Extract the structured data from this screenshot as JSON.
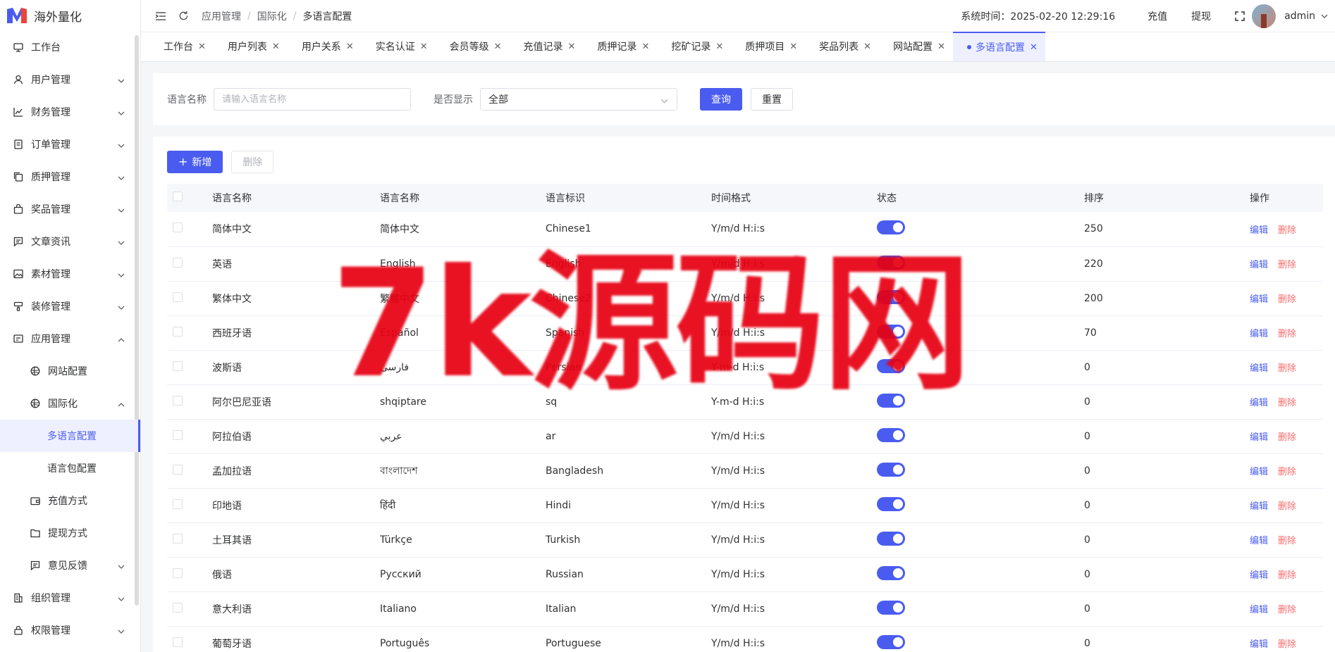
{
  "app": {
    "title": "海外量化"
  },
  "sidebar": {
    "items": [
      {
        "label": "工作台",
        "icon": "monitor-icon",
        "level": 0,
        "expandable": false
      },
      {
        "label": "用户管理",
        "icon": "user-icon",
        "level": 0,
        "expandable": true
      },
      {
        "label": "财务管理",
        "icon": "chart-icon",
        "level": 0,
        "expandable": true
      },
      {
        "label": "订单管理",
        "icon": "document-icon",
        "level": 0,
        "expandable": true
      },
      {
        "label": "质押管理",
        "icon": "copy-icon",
        "level": 0,
        "expandable": true
      },
      {
        "label": "奖品管理",
        "icon": "bag-icon",
        "level": 0,
        "expandable": true
      },
      {
        "label": "文章资讯",
        "icon": "message-icon",
        "level": 0,
        "expandable": true
      },
      {
        "label": "素材管理",
        "icon": "image-icon",
        "level": 0,
        "expandable": true
      },
      {
        "label": "装修管理",
        "icon": "brush-icon",
        "level": 0,
        "expandable": true
      },
      {
        "label": "应用管理",
        "icon": "app-icon",
        "level": 0,
        "expandable": true,
        "expanded": true
      },
      {
        "label": "网站配置",
        "icon": "globe-icon",
        "level": 1,
        "expandable": false
      },
      {
        "label": "国际化",
        "icon": "globe-icon",
        "level": 1,
        "expandable": true,
        "expanded": true
      },
      {
        "label": "多语言配置",
        "icon": "",
        "level": 2,
        "expandable": false,
        "active": true
      },
      {
        "label": "语言包配置",
        "icon": "",
        "level": 2,
        "expandable": false
      },
      {
        "label": "充值方式",
        "icon": "wallet-icon",
        "level": 1,
        "expandable": false
      },
      {
        "label": "提现方式",
        "icon": "folder-icon",
        "level": 1,
        "expandable": false
      },
      {
        "label": "意见反馈",
        "icon": "message-icon",
        "level": 1,
        "expandable": true
      },
      {
        "label": "组织管理",
        "icon": "building-icon",
        "level": 0,
        "expandable": true
      },
      {
        "label": "权限管理",
        "icon": "lock-icon",
        "level": 0,
        "expandable": true
      }
    ]
  },
  "header": {
    "breadcrumb": [
      "应用管理",
      "国际化",
      "多语言配置"
    ],
    "system_time": "系统时间：2025-02-20 12:29:16",
    "recharge": "充值",
    "withdraw": "提现",
    "user": "admin"
  },
  "tabs": [
    {
      "label": "工作台"
    },
    {
      "label": "用户列表"
    },
    {
      "label": "用户关系"
    },
    {
      "label": "实名认证"
    },
    {
      "label": "会员等级"
    },
    {
      "label": "充值记录"
    },
    {
      "label": "质押记录"
    },
    {
      "label": "挖矿记录"
    },
    {
      "label": "质押项目"
    },
    {
      "label": "奖品列表"
    },
    {
      "label": "网站配置"
    },
    {
      "label": "多语言配置",
      "active": true
    }
  ],
  "search": {
    "name_label": "语言名称",
    "name_placeholder": "请输入语言名称",
    "show_label": "是否显示",
    "show_value": "全部",
    "query": "查询",
    "reset": "重置"
  },
  "toolbar": {
    "add": "新增",
    "delete": "删除"
  },
  "table": {
    "columns": [
      "语言名称",
      "语言名称",
      "语言标识",
      "时间格式",
      "状态",
      "排序",
      "操作"
    ],
    "edit": "编辑",
    "remove": "删除",
    "rows": [
      {
        "name": "简体中文",
        "native": "简体中文",
        "code": "Chinese1",
        "fmt": "Y/m/d H:i:s",
        "on": true,
        "sort": "250"
      },
      {
        "name": "英语",
        "native": "English",
        "code": "English",
        "fmt": "Y/m/d H:i:s",
        "on": true,
        "sort": "220"
      },
      {
        "name": "繁体中文",
        "native": "繁體中文",
        "code": "Chinese2",
        "fmt": "Y/m/d H:i:s",
        "on": true,
        "sort": "200"
      },
      {
        "name": "西班牙语",
        "native": "Español",
        "code": "Spanish",
        "fmt": "Y/m/d H:i:s",
        "on": true,
        "sort": "70"
      },
      {
        "name": "波斯语",
        "native": "فارسی",
        "code": "Persian",
        "fmt": "Y-m-d H:i:s",
        "on": true,
        "sort": "0"
      },
      {
        "name": "阿尔巴尼亚语",
        "native": "shqiptare",
        "code": "sq",
        "fmt": "Y-m-d H:i:s",
        "on": true,
        "sort": "0"
      },
      {
        "name": "阿拉伯语",
        "native": "عربي",
        "code": "ar",
        "fmt": "Y/m/d H:i:s",
        "on": true,
        "sort": "0"
      },
      {
        "name": "孟加拉语",
        "native": "বাংলাদেশ",
        "code": "Bangladesh",
        "fmt": "Y/m/d H:i:s",
        "on": true,
        "sort": "0"
      },
      {
        "name": "印地语",
        "native": "हिंदी",
        "code": "Hindi",
        "fmt": "Y/m/d H:i:s",
        "on": true,
        "sort": "0"
      },
      {
        "name": "土耳其语",
        "native": "Türkçe",
        "code": "Turkish",
        "fmt": "Y/m/d H:i:s",
        "on": true,
        "sort": "0"
      },
      {
        "name": "俄语",
        "native": "Русский",
        "code": "Russian",
        "fmt": "Y/m/d H:i:s",
        "on": true,
        "sort": "0"
      },
      {
        "name": "意大利语",
        "native": "Italiano",
        "code": "Italian",
        "fmt": "Y/m/d H:i:s",
        "on": true,
        "sort": "0"
      },
      {
        "name": "葡萄牙语",
        "native": "Português",
        "code": "Portuguese",
        "fmt": "Y/m/d H:i:s",
        "on": true,
        "sort": "0"
      }
    ]
  },
  "watermark": "7k源码网",
  "colors": {
    "primary": "#4a5cf0",
    "danger": "#f56c6c",
    "watermark": "#e60012"
  }
}
